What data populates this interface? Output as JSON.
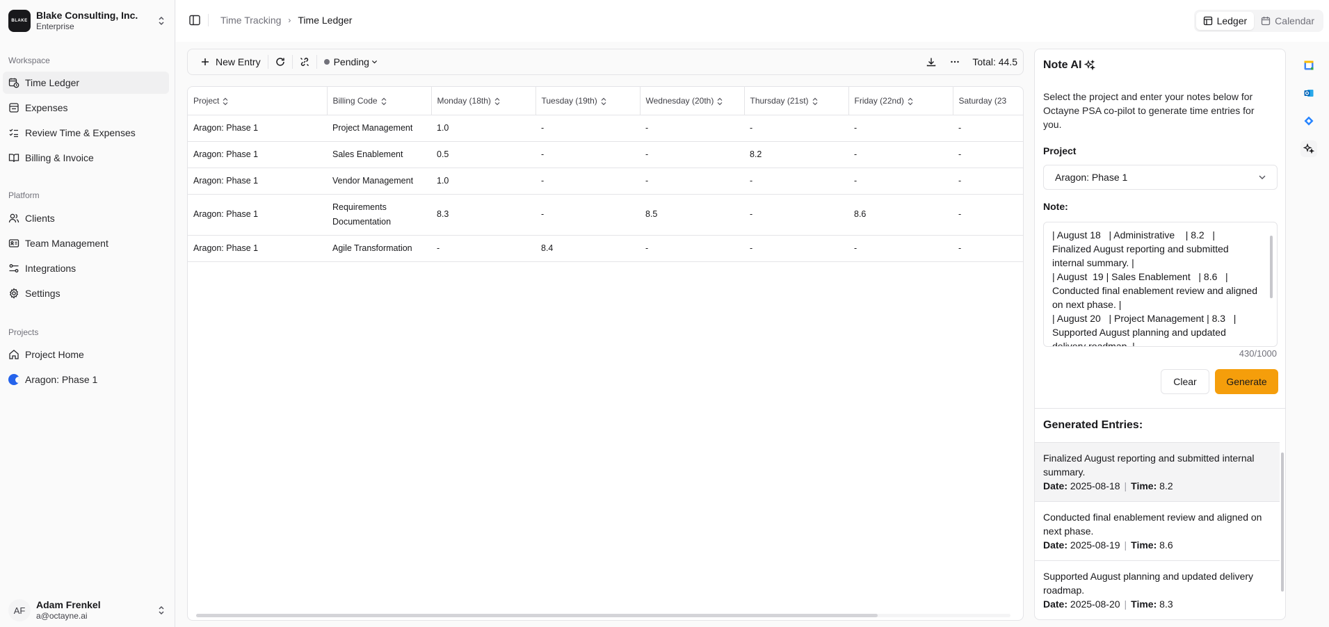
{
  "org": {
    "name": "Blake Consulting, Inc.",
    "plan": "Enterprise",
    "logo_text": "BLAKE"
  },
  "sidebar": {
    "workspace_label": "Workspace",
    "workspace_items": [
      {
        "label": "Time Ledger",
        "icon": "clock-calendar-icon"
      },
      {
        "label": "Expenses",
        "icon": "receipt-icon"
      },
      {
        "label": "Review Time & Expenses",
        "icon": "checklist-icon"
      },
      {
        "label": "Billing & Invoice",
        "icon": "book-icon"
      }
    ],
    "platform_label": "Platform",
    "platform_items": [
      {
        "label": "Clients",
        "icon": "users-icon"
      },
      {
        "label": "Team Management",
        "icon": "id-card-icon"
      },
      {
        "label": "Integrations",
        "icon": "sliders-icon"
      },
      {
        "label": "Settings",
        "icon": "gear-icon"
      }
    ],
    "projects_label": "Projects",
    "project_items": [
      {
        "label": "Project Home",
        "icon": "home-icon"
      },
      {
        "label": "Aragon: Phase 1",
        "icon": "project-logo-icon"
      }
    ]
  },
  "user": {
    "initials": "AF",
    "name": "Adam Frenkel",
    "email": "a@octayne.ai"
  },
  "header": {
    "breadcrumb": [
      "Time Tracking",
      "Time Ledger"
    ],
    "views": [
      "Ledger",
      "Calendar"
    ]
  },
  "toolbar": {
    "new_entry": "New Entry",
    "status": "Pending",
    "total": "Total: 44.5"
  },
  "table": {
    "columns": [
      "Project",
      "Billing Code",
      "Monday (18th)",
      "Tuesday (19th)",
      "Wednesday (20th)",
      "Thursday (21st)",
      "Friday (22nd)",
      "Saturday (23"
    ],
    "rows": [
      [
        "Aragon: Phase 1",
        "Project Management",
        "1.0",
        "-",
        "-",
        "-",
        "-",
        "-"
      ],
      [
        "Aragon: Phase 1",
        "Sales Enablement",
        "0.5",
        "-",
        "-",
        "8.2",
        "-",
        "-"
      ],
      [
        "Aragon: Phase 1",
        "Vendor Management",
        "1.0",
        "-",
        "-",
        "-",
        "-",
        "-"
      ],
      [
        "Aragon: Phase 1",
        "Requirements Documentation",
        "8.3",
        "-",
        "8.5",
        "-",
        "8.6",
        "-"
      ],
      [
        "Aragon: Phase 1",
        "Agile Transformation",
        "-",
        "8.4",
        "-",
        "-",
        "-",
        "-"
      ]
    ]
  },
  "ai": {
    "title": "Note AI",
    "description": "Select the project and enter your notes below for Octayne PSA co-pilot to generate time entries for you.",
    "project_label": "Project",
    "project_value": "Aragon: Phase 1",
    "note_label": "Note:",
    "note_text": "| August 18   | Administrative    | 8.2   |\nFinalized August reporting and submitted internal summary. |\n| August  19 | Sales Enablement   | 8.6   |\nConducted final enablement review and aligned on next phase. |\n| August 20   | Project Management | 8.3   |\nSupported August planning and updated delivery roadmap. |",
    "char_count": "430/1000",
    "clear": "Clear",
    "generate": "Generate",
    "generated_title": "Generated Entries:",
    "entries": [
      {
        "text": "Finalized August reporting and submitted internal summary.",
        "date": "2025-08-18",
        "time": "8.2"
      },
      {
        "text": "Conducted final enablement review and aligned on next phase.",
        "date": "2025-08-19",
        "time": "8.6"
      },
      {
        "text": "Supported August planning and updated delivery roadmap.",
        "date": "2025-08-20",
        "time": "8.3"
      }
    ],
    "date_label": "Date:",
    "time_label": "Time:"
  },
  "colors": {
    "accent": "#f59e0b",
    "project_logo": "#2563eb"
  }
}
